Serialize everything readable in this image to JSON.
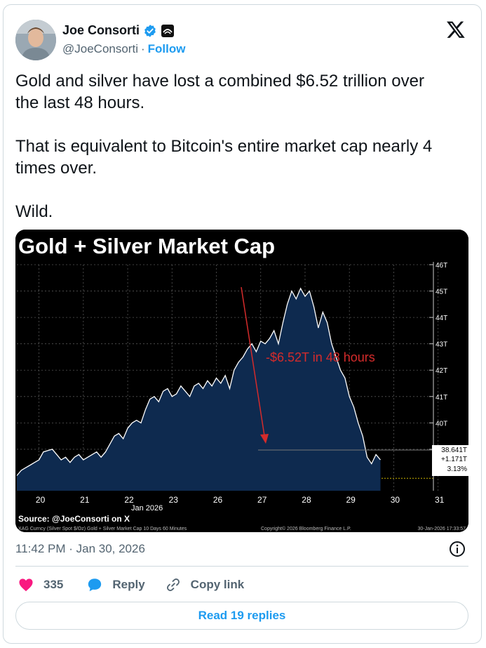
{
  "author": {
    "name": "Joe Consorti",
    "handle": "@JoeConsorti",
    "separator": "·",
    "follow_label": "Follow"
  },
  "tweet": {
    "text": "Gold and silver have lost a combined $6.52 trillion over\nthe last 48 hours.\n\nThat is equivalent to Bitcoin's entire market cap nearly 4\ntimes over.\n\nWild.",
    "timestamp": "11:42 PM · Jan 30, 2026"
  },
  "actions": {
    "likes": "335",
    "reply_label": "Reply",
    "copy_link_label": "Copy link",
    "read_replies_label": "Read 19 replies"
  },
  "colors": {
    "like": "#f91880",
    "reply": "#1d9bf0",
    "accent": "#1d9bf0",
    "chart_fill": "#0e2a4f",
    "chart_arrow": "#d42b2b"
  },
  "chart_data": {
    "type": "area",
    "title": "Gold + Silver Market Cap",
    "x_tick_labels": [
      "20",
      "21",
      "22",
      "23",
      "26",
      "27",
      "28",
      "29",
      "30",
      "31"
    ],
    "x_sublabel": "Jan 2026",
    "y_tick_labels": [
      "46T",
      "45T",
      "44T",
      "43T",
      "42T",
      "41T",
      "40T",
      "39T"
    ],
    "ylim": [
      37.8,
      46
    ],
    "annotation": "-$6.52T in 48 hours",
    "last_value_labels": [
      "38.641T",
      "+1.171T",
      "3.13%"
    ],
    "source_label": "Source: @JoeConsorti on X",
    "footer_left": "XAG Curncy (Silver Spot $/Oz) Gold + Silver Market Cap 10 Days 60 Minutes",
    "footer_mid": "Copyright© 2026 Bloomberg Finance L.P.",
    "footer_right": "30-Jan-2026 17:33:57",
    "series": [
      {
        "x": [
          0,
          0.1,
          0.2,
          0.3,
          0.4,
          0.5,
          0.6,
          0.7,
          0.8,
          0.9,
          1.0,
          1.1,
          1.2,
          1.3,
          1.4,
          1.5,
          1.6,
          1.7,
          1.8,
          1.9,
          2.0,
          2.1,
          2.2,
          2.3,
          2.4,
          2.5,
          2.6,
          2.7,
          2.8,
          2.9,
          3.0,
          3.1,
          3.2,
          3.3,
          3.4,
          3.5,
          3.6,
          3.7,
          3.8,
          3.9,
          4.0,
          4.1,
          4.2,
          4.3,
          4.4,
          4.5,
          4.6,
          4.7,
          4.8,
          4.9,
          5.0,
          5.1,
          5.2,
          5.3,
          5.4,
          5.5,
          5.6,
          5.7,
          5.8,
          5.9,
          6.0,
          6.1,
          6.2,
          6.3,
          6.4,
          6.5,
          6.6,
          6.7,
          6.8,
          6.9,
          7.0,
          7.1,
          7.2,
          7.3,
          7.4,
          7.5,
          7.6,
          7.7,
          7.8,
          7.9,
          8.0,
          8.1,
          8.2,
          8.3,
          8.4,
          8.5
        ],
        "y": [
          38.0,
          38.2,
          38.3,
          38.4,
          38.5,
          38.6,
          38.9,
          38.95,
          39.0,
          38.8,
          38.6,
          38.7,
          38.5,
          38.7,
          38.8,
          38.6,
          38.7,
          38.8,
          38.9,
          38.7,
          38.9,
          39.2,
          39.5,
          39.6,
          39.4,
          39.8,
          40.0,
          40.1,
          40.0,
          40.5,
          40.9,
          41.0,
          40.8,
          41.2,
          41.3,
          41.0,
          41.1,
          41.4,
          41.2,
          41.0,
          41.4,
          41.5,
          41.3,
          41.6,
          41.4,
          41.7,
          41.5,
          41.8,
          41.3,
          42.0,
          42.3,
          42.5,
          42.8,
          43.0,
          42.7,
          43.1,
          43.0,
          43.2,
          43.5,
          43.0,
          43.8,
          44.5,
          45.0,
          44.7,
          45.1,
          44.8,
          45.0,
          44.4,
          43.6,
          44.2,
          43.8,
          43.0,
          42.5,
          42.0,
          41.7,
          41.0,
          40.6,
          40.0,
          39.5,
          38.7,
          38.45,
          38.8,
          38.6,
          null,
          null,
          null
        ]
      }
    ]
  }
}
